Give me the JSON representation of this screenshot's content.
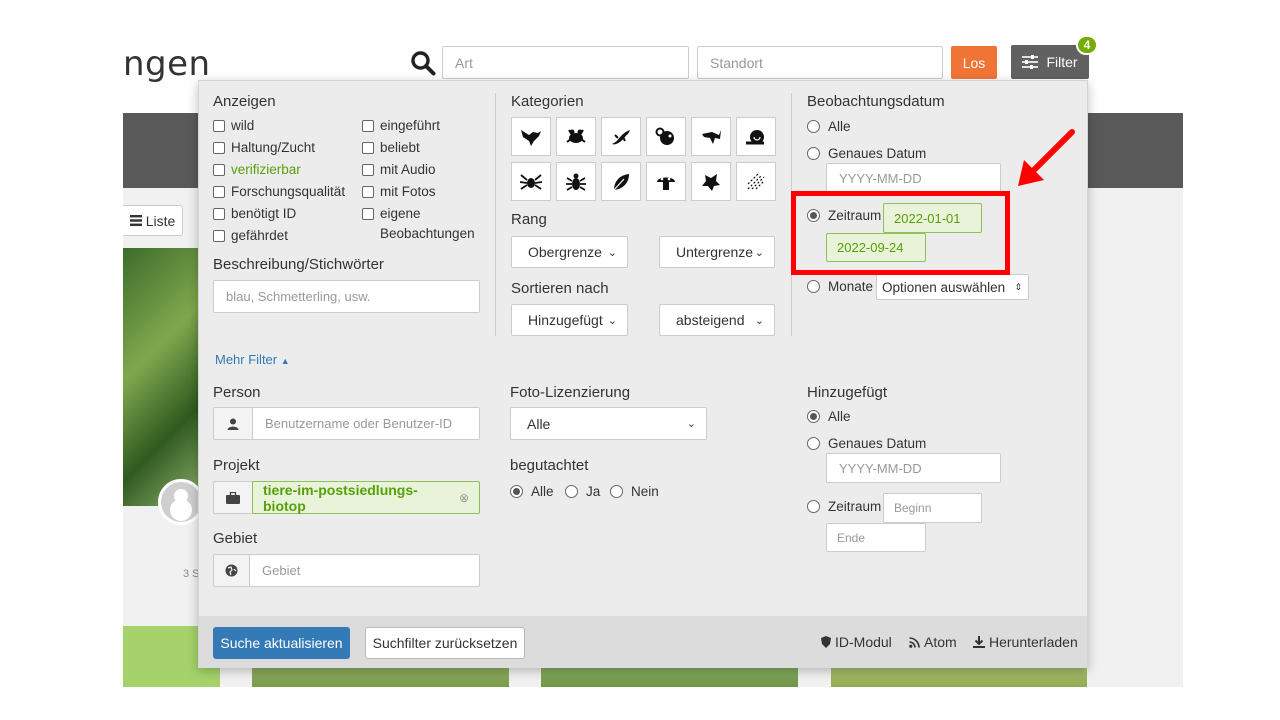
{
  "page": {
    "title_fragment": "ngen",
    "liste_label": "Liste",
    "bg_small_text": "3 S"
  },
  "search": {
    "art_placeholder": "Art",
    "standort_placeholder": "Standort",
    "go_label": "Los",
    "filter_label": "Filter",
    "filter_count": "4"
  },
  "colors": {
    "go_button": "#f07436",
    "filter_button": "#616161",
    "badge": "#74ac00",
    "active_green": "#57a008",
    "primary_blue": "#337ab7",
    "annotation_red": "#ff0000"
  },
  "anzeigen": {
    "heading": "Anzeigen",
    "left": [
      "wild",
      "Haltung/Zucht",
      "verifizierbar",
      "Forschungsqualität",
      "benötigt ID",
      "gefährdet"
    ],
    "right": [
      "eingeführt",
      "beliebt",
      "mit Audio",
      "mit Fotos",
      "eigene",
      "Beobachtungen"
    ],
    "highlighted": "verifizierbar"
  },
  "beschreibung": {
    "heading": "Beschreibung/Stichwörter",
    "placeholder": "blau, Schmetterling, usw."
  },
  "kategorien": {
    "heading": "Kategorien",
    "icons": [
      "bird-icon",
      "amphibian-icon",
      "reptile-icon",
      "mammal-icon",
      "fish-icon",
      "mollusk-icon",
      "arachnid-icon",
      "insect-icon",
      "plant-icon",
      "fungus-icon",
      "protozoa-icon",
      "unknown-icon"
    ]
  },
  "rang": {
    "heading": "Rang",
    "upper": "Obergrenze",
    "lower": "Untergrenze"
  },
  "sortieren": {
    "heading": "Sortieren nach",
    "field": "Hinzugefügt",
    "order": "absteigend"
  },
  "beobachtungsdatum": {
    "heading": "Beobachtungsdatum",
    "option_all": "Alle",
    "option_exact": "Genaues Datum",
    "exact_placeholder": "YYYY-MM-DD",
    "option_range": "Zeitraum",
    "range_start": "2022-01-01",
    "range_end": "2022-09-24",
    "option_months": "Monate",
    "months_select": "Optionen auswählen",
    "selected": "Zeitraum"
  },
  "mehr_filter": "Mehr Filter",
  "person": {
    "heading": "Person",
    "placeholder": "Benutzername oder Benutzer-ID"
  },
  "projekt": {
    "heading": "Projekt",
    "value": "tiere-im-postsiedlungs-biotop"
  },
  "gebiet": {
    "heading": "Gebiet",
    "placeholder": "Gebiet"
  },
  "foto_lizenz": {
    "heading": "Foto-Lizenzierung",
    "value": "Alle"
  },
  "begutachtet": {
    "heading": "begutachtet",
    "options": [
      "Alle",
      "Ja",
      "Nein"
    ],
    "selected": "Alle"
  },
  "hinzugefuegt": {
    "heading": "Hinzugefügt",
    "option_all": "Alle",
    "option_exact": "Genaues Datum",
    "exact_placeholder": "YYYY-MM-DD",
    "option_range": "Zeitraum",
    "begin_placeholder": "Beginn",
    "end_placeholder": "Ende",
    "selected": "Alle"
  },
  "footer": {
    "update_label": "Suche aktualisieren",
    "reset_label": "Suchfilter zurücksetzen",
    "id_module": "ID-Modul",
    "atom": "Atom",
    "download": "Herunterladen"
  }
}
